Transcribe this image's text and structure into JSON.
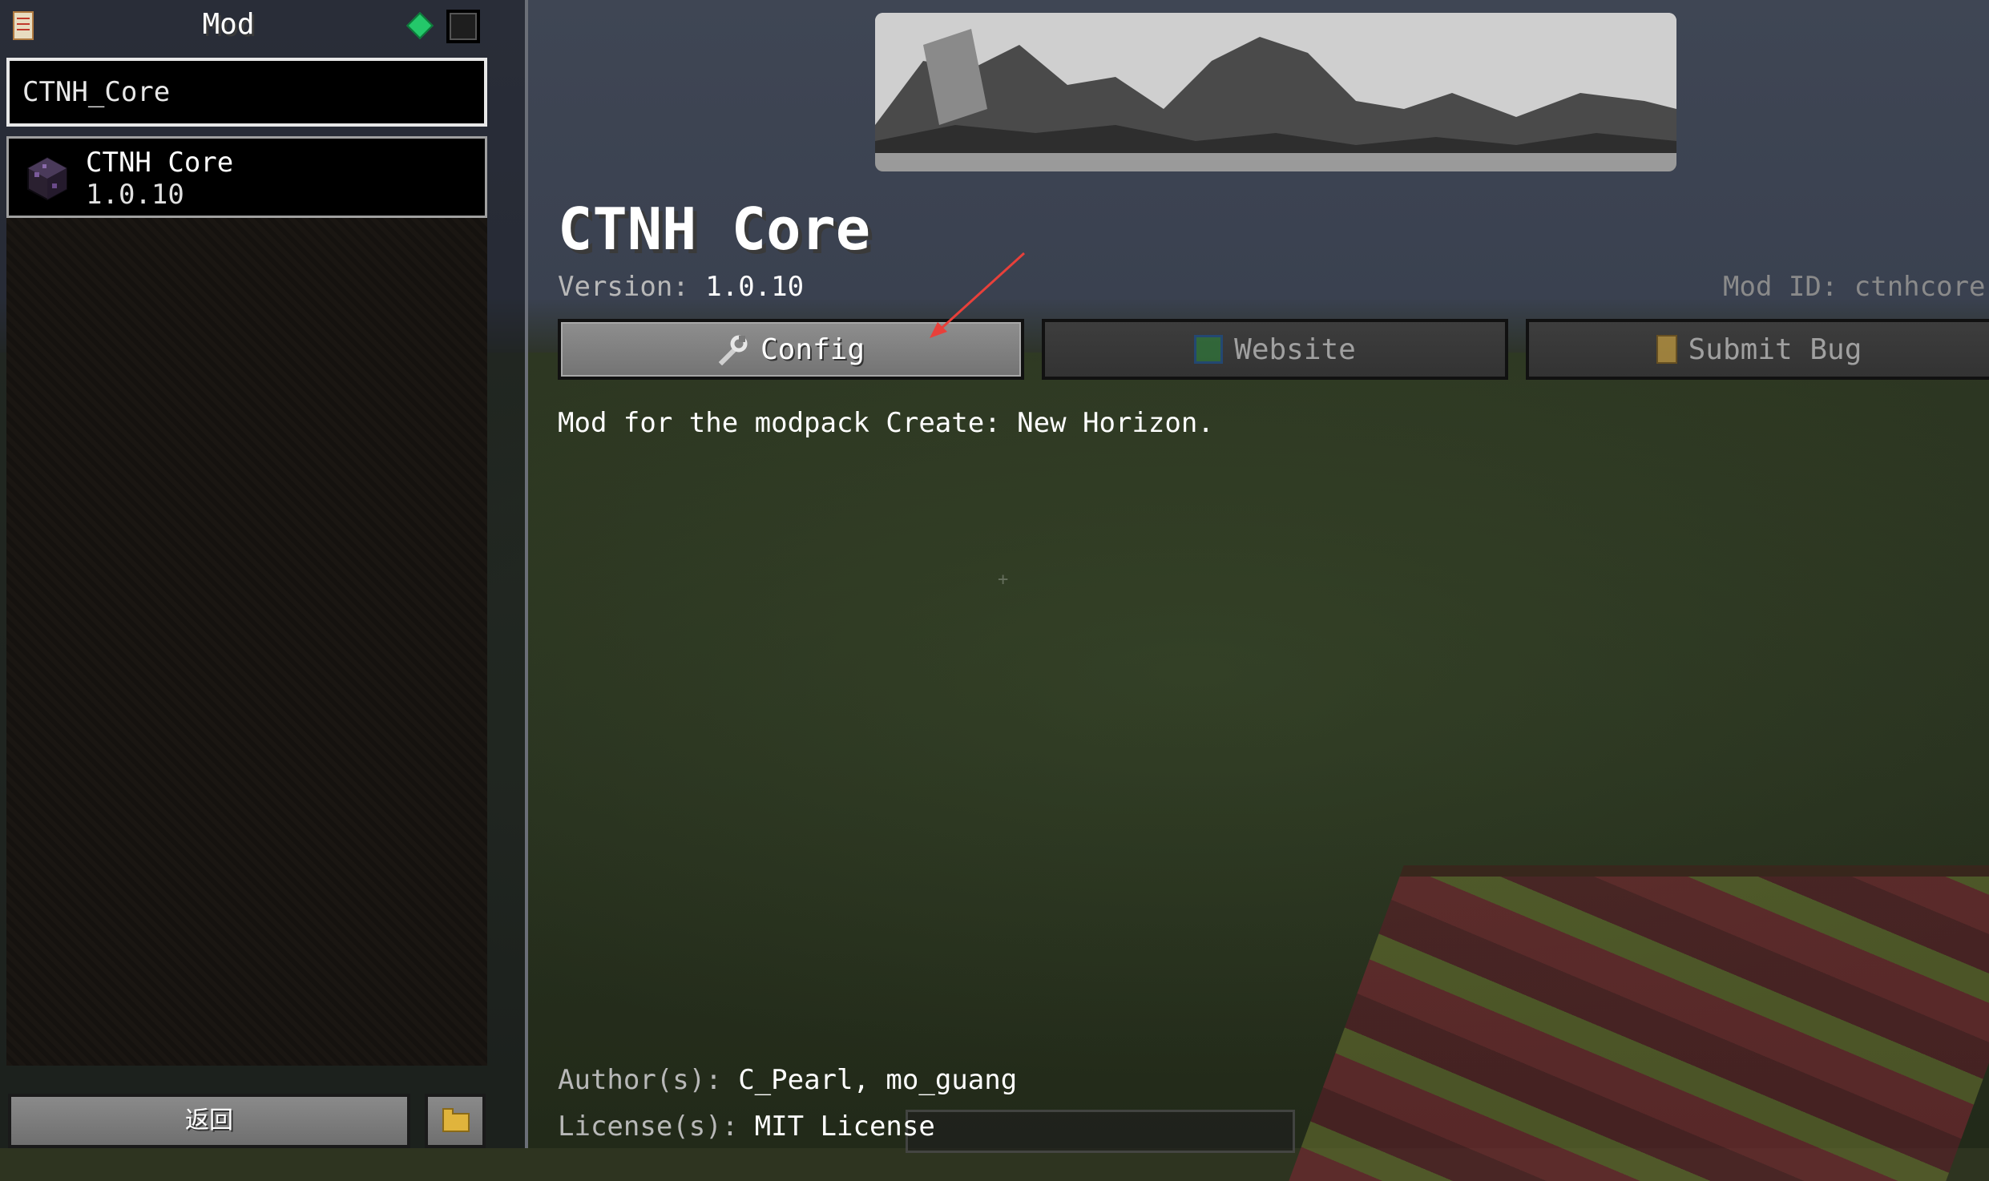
{
  "left_panel": {
    "title": "Mod",
    "search": {
      "value": "CTNH_Core",
      "placeholder": ""
    },
    "mods": [
      {
        "name": "CTNH Core",
        "version": "1.0.10"
      }
    ],
    "back_label": "返回"
  },
  "details": {
    "title": "CTNH Core",
    "version_label": "Version:",
    "version_value": "1.0.10",
    "mod_id_text": "Mod ID: ctnhcore",
    "buttons": {
      "config": "Config",
      "website": "Website",
      "submit_bug": "Submit Bug"
    },
    "description": "Mod for the modpack Create: New Horizon.",
    "authors_label": "Author(s):",
    "authors_value": "C_Pearl, mo_guang",
    "license_label": "License(s):",
    "license_value": "MIT License"
  },
  "icons": {
    "notes": "notes-icon",
    "gem": "emerald-icon",
    "box": "config-box-icon",
    "mod": "mod-cube-icon",
    "wrench": "wrench-icon",
    "globe": "globe-icon",
    "clipboard": "clipboard-icon",
    "folder": "folder-icon"
  },
  "colors": {
    "annotation_arrow": "#e8403a",
    "gem": "#24c86a",
    "muted_text": "#a0a0a0"
  }
}
